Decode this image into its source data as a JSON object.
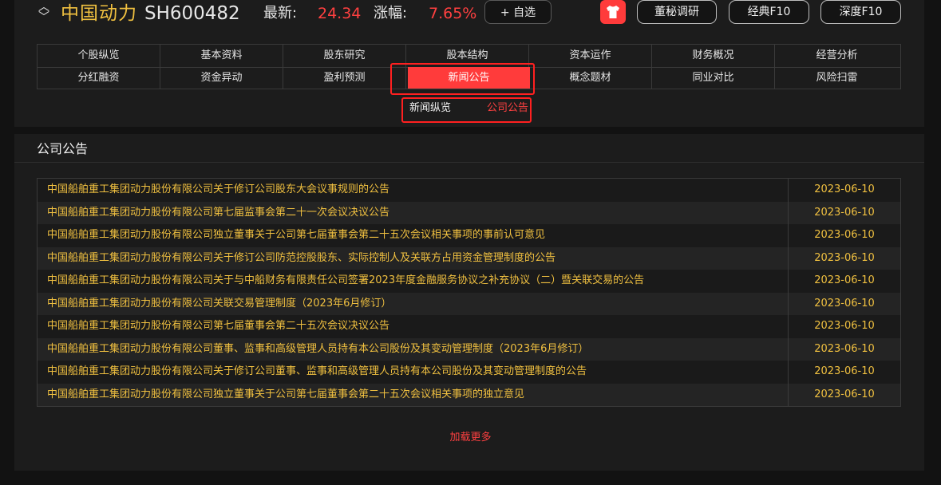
{
  "header": {
    "stock_name": "中国动力",
    "stock_code": "SH600482",
    "latest_label": "最新:",
    "latest_value": "24.34",
    "change_label": "涨幅:",
    "change_value": "7.65%",
    "watch_button": "+ 自选",
    "buttons": [
      "董秘调研",
      "经典F10",
      "深度F10"
    ]
  },
  "nav": {
    "row1": [
      "个股纵览",
      "基本资料",
      "股东研究",
      "股本结构",
      "资本运作",
      "财务概况",
      "经营分析"
    ],
    "row2": [
      "分红融资",
      "资金异动",
      "盈利预测",
      "新闻公告",
      "概念题材",
      "同业对比",
      "风险扫雷"
    ],
    "active": "新闻公告"
  },
  "subtabs": {
    "news": "新闻纵览",
    "announcements": "公司公告"
  },
  "section": {
    "title": "公司公告"
  },
  "announcements": [
    {
      "title": "中国船舶重工集团动力股份有限公司关于修订公司股东大会议事规则的公告",
      "date": "2023-06-10"
    },
    {
      "title": "中国船舶重工集团动力股份有限公司第七届监事会第二十一次会议决议公告",
      "date": "2023-06-10"
    },
    {
      "title": "中国船舶重工集团动力股份有限公司独立董事关于公司第七届董事会第二十五次会议相关事项的事前认可意见",
      "date": "2023-06-10"
    },
    {
      "title": "中国船舶重工集团动力股份有限公司关于修订公司防范控股股东、实际控制人及关联方占用资金管理制度的公告",
      "date": "2023-06-10"
    },
    {
      "title": "中国船舶重工集团动力股份有限公司关于与中船财务有限责任公司签署2023年度金融服务协议之补充协议（二）暨关联交易的公告",
      "date": "2023-06-10"
    },
    {
      "title": "中国船舶重工集团动力股份有限公司关联交易管理制度（2023年6月修订）",
      "date": "2023-06-10"
    },
    {
      "title": "中国船舶重工集团动力股份有限公司第七届董事会第二十五次会议决议公告",
      "date": "2023-06-10"
    },
    {
      "title": "中国船舶重工集团动力股份有限公司董事、监事和高级管理人员持有本公司股份及其变动管理制度（2023年6月修订）",
      "date": "2023-06-10"
    },
    {
      "title": "中国船舶重工集团动力股份有限公司关于修订公司董事、监事和高级管理人员持有本公司股份及其变动管理制度的公告",
      "date": "2023-06-10"
    },
    {
      "title": "中国船舶重工集团动力股份有限公司独立董事关于公司第七届董事会第二十五次会议相关事项的独立意见",
      "date": "2023-06-10"
    }
  ],
  "load_more": "加载更多",
  "colors": {
    "accent_red": "#ff3b3b",
    "gold_text": "#f0c040",
    "background": "#121212"
  }
}
